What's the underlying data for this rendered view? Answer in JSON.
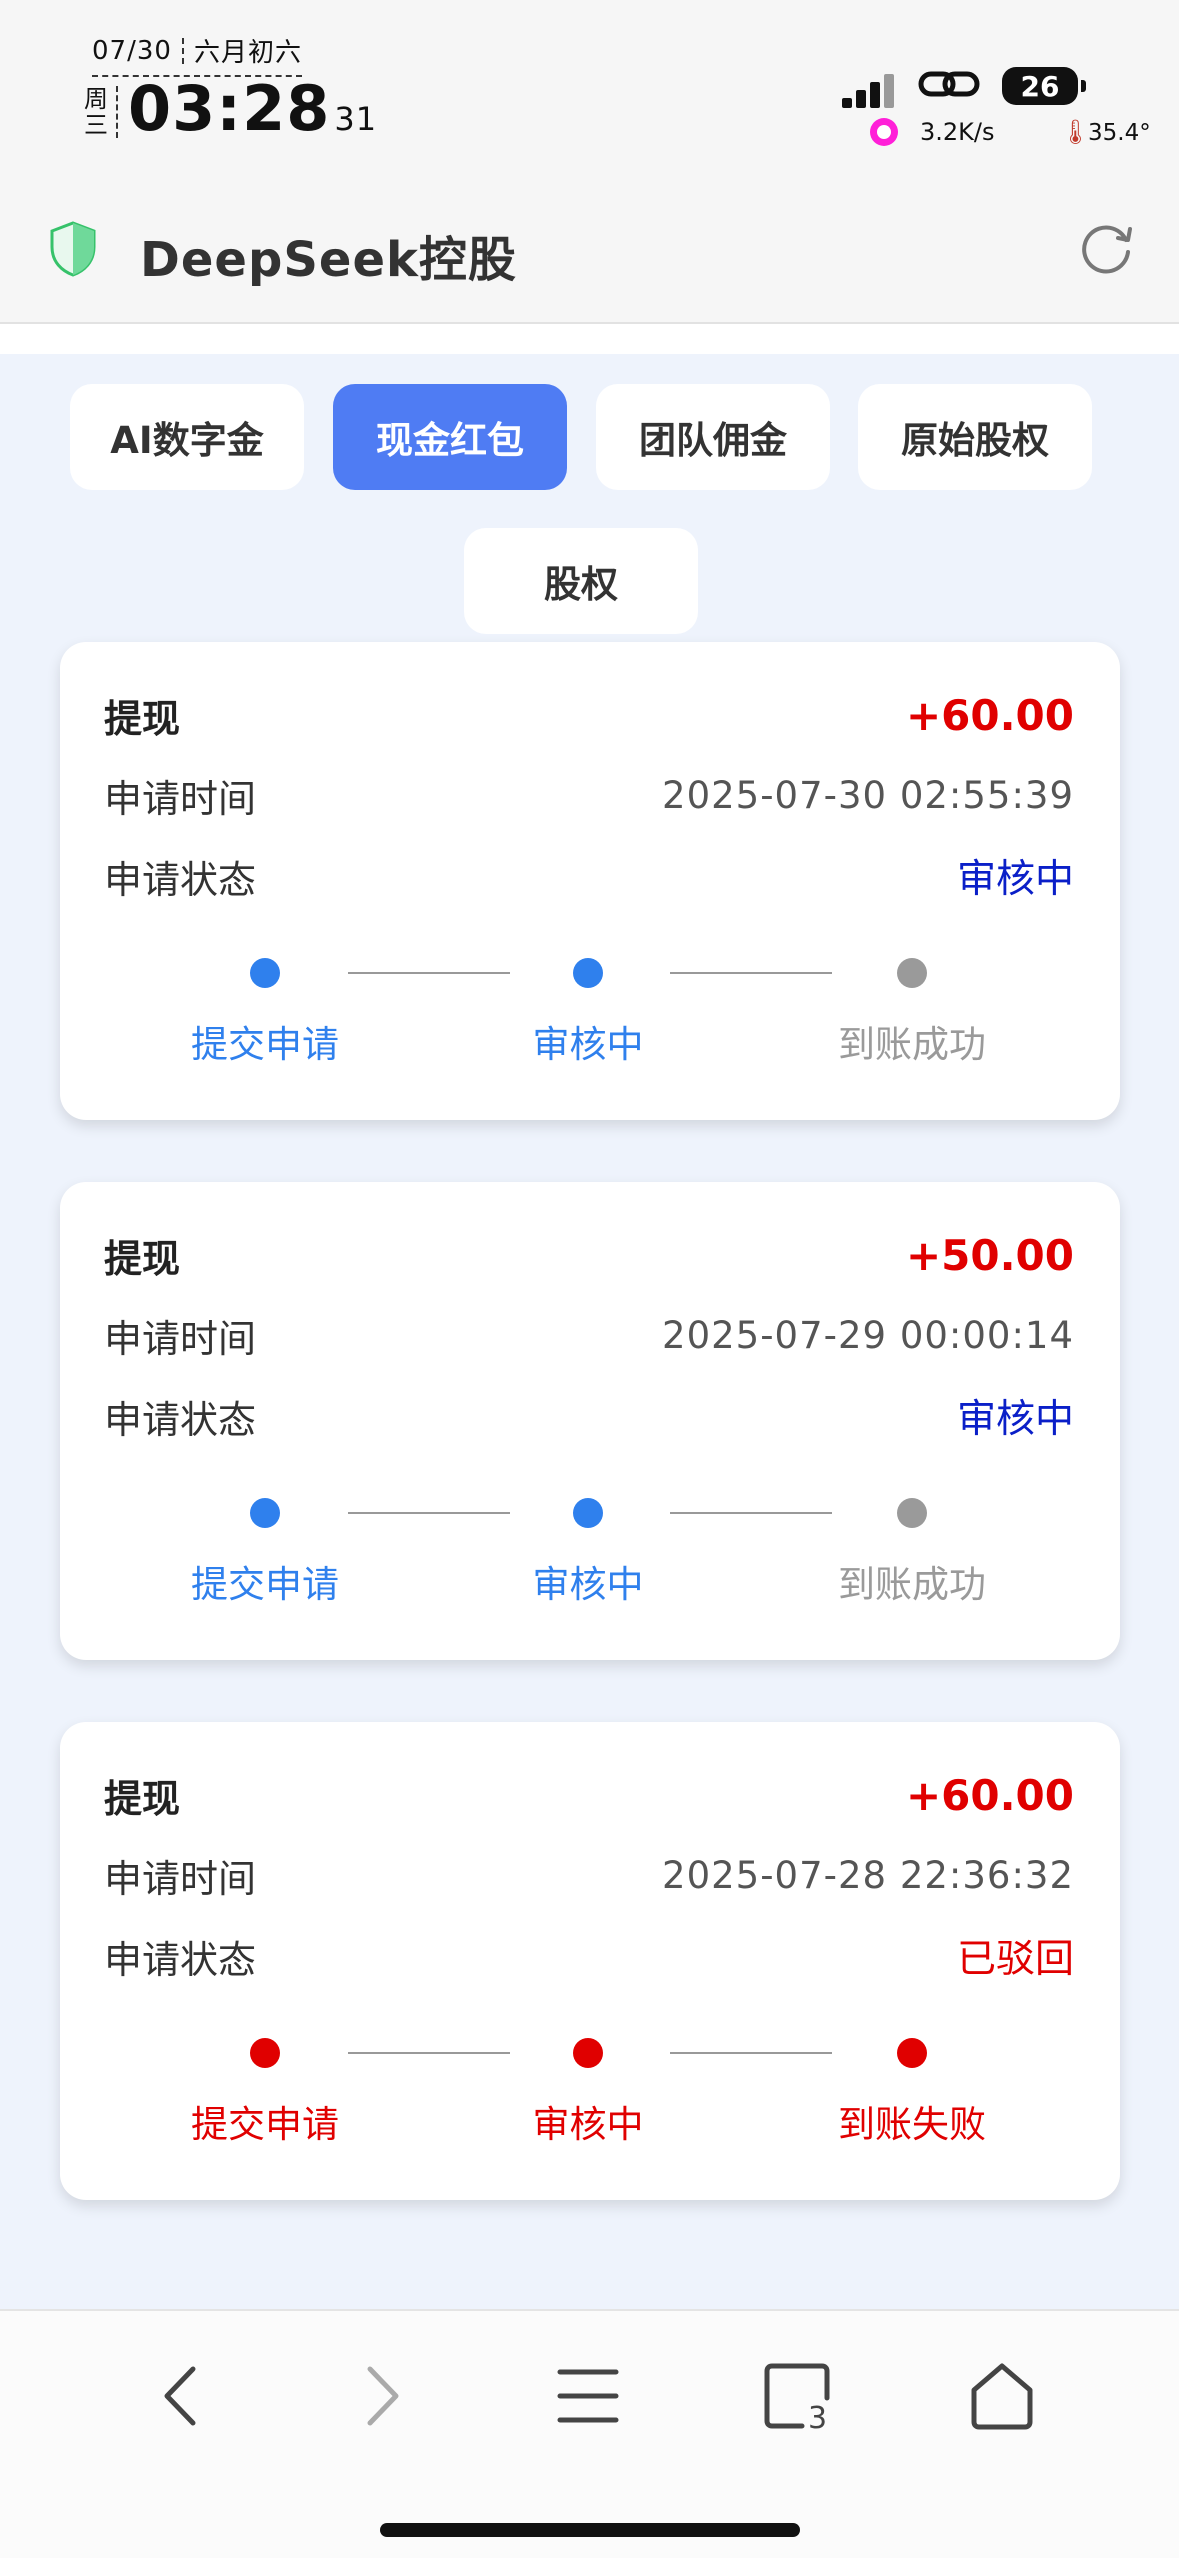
{
  "status_bar": {
    "date": "07/30",
    "lunar": "六月初六",
    "weekday": "周三",
    "time": "03:28",
    "seconds": "31",
    "battery": "26",
    "net_speed": "3.2K/s",
    "temperature": "35.4°"
  },
  "header": {
    "title": "DeepSeek控股"
  },
  "tabs": [
    {
      "label": "AI数字金",
      "active": false
    },
    {
      "label": "现金红包",
      "active": true
    },
    {
      "label": "团队佣金",
      "active": false
    },
    {
      "label": "原始股权",
      "active": false
    },
    {
      "label": "股权",
      "active": false
    }
  ],
  "records": [
    {
      "type": "提现",
      "amount": "+60.00",
      "time_label": "申请时间",
      "time": "2025-07-30 02:55:39",
      "status_label": "申请状态",
      "status": "审核中",
      "status_color": "#0a1fc8",
      "steps": [
        {
          "label": "提交申请",
          "color": "#2f80ed"
        },
        {
          "label": "审核中",
          "color": "#2f80ed"
        },
        {
          "label": "到账成功",
          "color": "#9a9a9a"
        }
      ]
    },
    {
      "type": "提现",
      "amount": "+50.00",
      "time_label": "申请时间",
      "time": "2025-07-29 00:00:14",
      "status_label": "申请状态",
      "status": "审核中",
      "status_color": "#0a1fc8",
      "steps": [
        {
          "label": "提交申请",
          "color": "#2f80ed"
        },
        {
          "label": "审核中",
          "color": "#2f80ed"
        },
        {
          "label": "到账成功",
          "color": "#9a9a9a"
        }
      ]
    },
    {
      "type": "提现",
      "amount": "+60.00",
      "time_label": "申请时间",
      "time": "2025-07-28 22:36:32",
      "status_label": "申请状态",
      "status": "已驳回",
      "status_color": "#e00000",
      "steps": [
        {
          "label": "提交申请",
          "color": "#e00000"
        },
        {
          "label": "审核中",
          "color": "#e00000"
        },
        {
          "label": "到账失败",
          "color": "#e00000"
        }
      ]
    }
  ],
  "bottom_nav": {
    "tab_count": "3",
    "icons": [
      "back-icon",
      "forward-icon",
      "menu-icon",
      "tabs-icon",
      "home-icon"
    ]
  },
  "colors": {
    "accent": "#4f7cf3",
    "amount": "#e00000",
    "step_active": "#2f80ed",
    "step_inactive": "#9a9a9a"
  }
}
